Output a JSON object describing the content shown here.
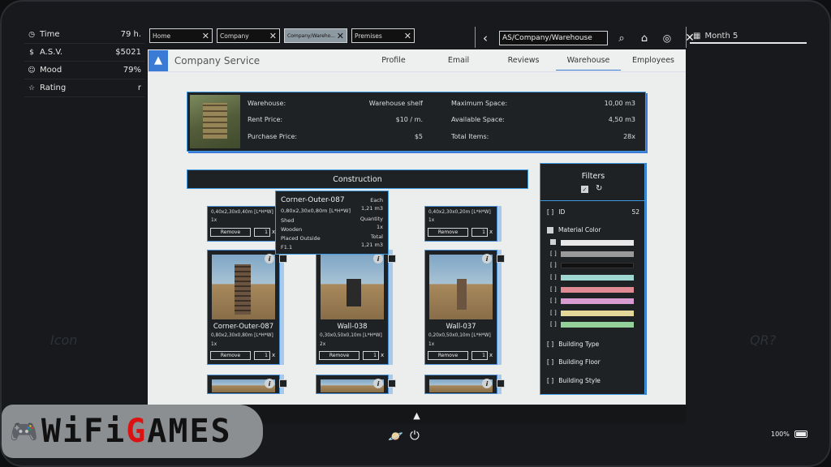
{
  "stats": [
    {
      "icon": "clock-icon",
      "glyph": "◷",
      "label": "Time",
      "value": "79 h."
    },
    {
      "icon": "dollar-icon",
      "glyph": "$",
      "label": "A.S.V.",
      "value": "$5021"
    },
    {
      "icon": "smiley-icon",
      "glyph": "☺",
      "label": "Mood",
      "value": "79%"
    },
    {
      "icon": "star-icon",
      "glyph": "☆",
      "label": "Rating",
      "value": "r"
    }
  ],
  "month": "Month 5",
  "tabs": [
    {
      "label": "Home"
    },
    {
      "label": "Company"
    },
    {
      "label": "Company/Wareho..."
    },
    {
      "label": "Premises"
    }
  ],
  "address": "AS/Company/Warehouse",
  "company": "Company Service",
  "menu": [
    "Profile",
    "Email",
    "Reviews",
    "Warehouse",
    "Employees"
  ],
  "warehouse": {
    "warehouse_label": "Warehouse:",
    "warehouse_value": "Warehouse shelf",
    "rent_label": "Rent Price:",
    "rent_value": "$10 / m.",
    "purchase_label": "Purchase Price:",
    "purchase_value": "$5",
    "max_label": "Maximum Space:",
    "max_value": "10,00 m3",
    "avail_label": "Available Space:",
    "avail_value": "4,50 m3",
    "total_label": "Total Items:",
    "total_value": "28x"
  },
  "construction": "Construction",
  "top_items": [
    {
      "dims": "0,40x2,30x0,40m [L*H*W]",
      "count": "1x",
      "remove": "Remove",
      "qty": "1"
    },
    {
      "dims": "0,40x2,30x0,20m [L*H*W]",
      "count": "1x",
      "remove": "Remove",
      "qty": "1"
    }
  ],
  "items": [
    {
      "name": "Corner-Outer-087",
      "dims": "0,80x2,30x0,80m [L*H*W]",
      "count": "1x",
      "remove": "Remove",
      "qty": "1"
    },
    {
      "name": "Wall-038",
      "dims": "0,30x0,50x0,10m [L*H*W]",
      "count": "2x",
      "remove": "Remove",
      "qty": "1"
    },
    {
      "name": "Wall-037",
      "dims": "0,20x0,50x0,10m [L*H*W]",
      "count": "1x",
      "remove": "Remove",
      "qty": "1"
    }
  ],
  "tooltip": {
    "title": "Corner-Outer-087",
    "each": "Each",
    "each_value": "1,21 m3",
    "dims": "0,80x2,30x0,80m [L*H*W]",
    "type": "Shed",
    "material": "Wooden",
    "placed": "Placed Outside",
    "floor": "F1.1",
    "quantity_label": "Quantity",
    "quantity_value": "1x",
    "total_label": "Total",
    "total_value": "1,21 m3"
  },
  "filters": {
    "title": "Filters",
    "id_label": "ID",
    "id_value": "52",
    "material_color": "Material Color",
    "swatches": [
      "#e8e8e8",
      "#9a9a9a",
      "#111111",
      "#9fd8d2",
      "#e08a94",
      "#d79bd0",
      "#e3d79a",
      "#93d09a"
    ],
    "building_type": "Building Type",
    "building_floor": "Building Floor",
    "building_style": "Building Style"
  },
  "battery": "100%",
  "watermark_prefix": "WiFi",
  "watermark_accent": "G",
  "watermark_suffix": "AMES",
  "bg_left": "Icon",
  "bg_right": "QR?"
}
